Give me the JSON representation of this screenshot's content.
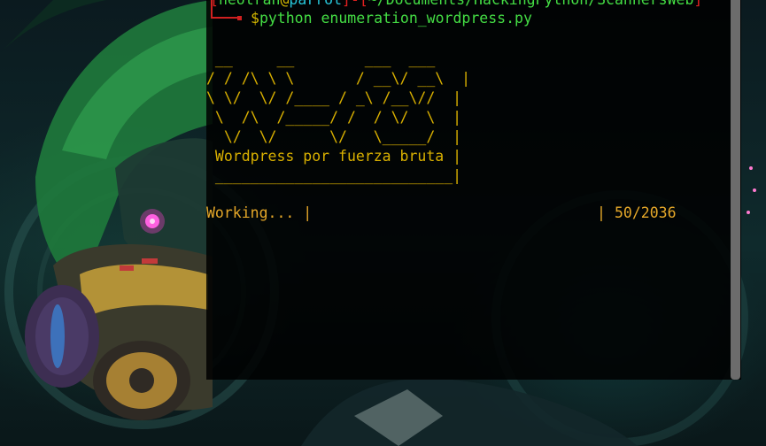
{
  "terminal": {
    "prompt": {
      "open_bracket": "[",
      "user": "neotran",
      "at": "@",
      "host": "parrot",
      "close_bracket": "]",
      "dash": "-",
      "path_open": "[",
      "path": "~/Documents/HackingPython/ScannersWeb",
      "path_close": "]",
      "symbol": "$",
      "command": "python enumeration_wordpress.py"
    },
    "banner_lines": [
      " __     __        ___  ___",
      "/ / /\\ \\ \\       / __\\/ __\\  |",
      "\\ \\/  \\/ /____ / _\\ /__\\//  |",
      " \\  /\\  /_____/ /  / \\/  \\  |",
      "  \\/  \\/      \\/   \\_____/  |",
      " Wordpress por fuerza bruta |",
      " ___________________________|"
    ],
    "progress": {
      "label": "Working... |",
      "bar_end": "|",
      "count": "50/2036"
    }
  },
  "colors": {
    "terminal_bg": "#000000",
    "prompt_red": "#e0201f",
    "prompt_green": "#44dd44",
    "prompt_cyan": "#27c5d8",
    "banner_yellow": "#d9b000",
    "progress_orange": "#e6a829",
    "scrollbar": "#6c6c6c"
  },
  "wallpaper": {
    "subject": "hooded figure with gas mask and glowing pink eye"
  }
}
